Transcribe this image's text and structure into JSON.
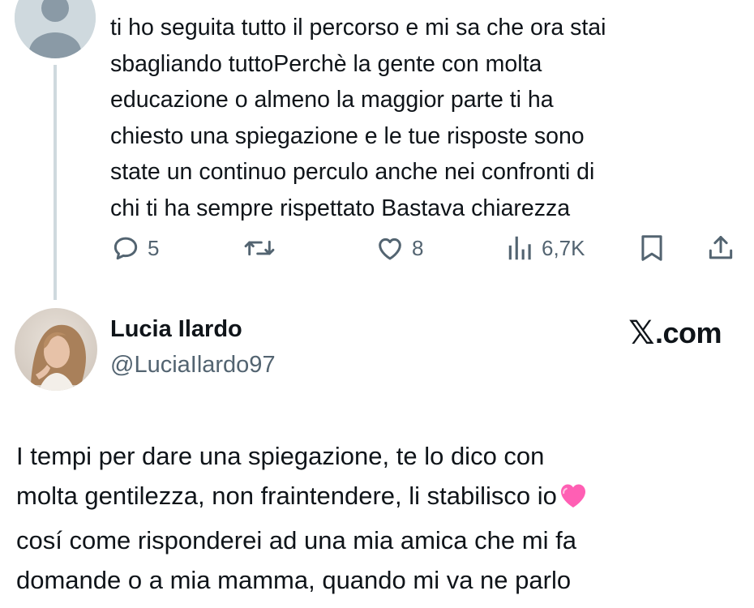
{
  "reply": {
    "text": "ti ho seguita tutto il percorso e mi sa che ora stai\nsbagliando tuttoPerchè la gente con molta\neducazione o almeno la maggior parte ti ha\nchiesto una spiegazione e le tue risposte sono\nstate un continuo perculo anche nei confronti di\nchi ti ha sempre rispettato Bastava chiarezza",
    "stats": {
      "replies": "5",
      "likes": "8",
      "views": "6,7K"
    },
    "icons": {
      "reply": "reply-icon",
      "retweet": "retweet-icon",
      "like": "heart-icon",
      "views": "views-icon",
      "bookmark": "bookmark-icon",
      "share": "share-icon"
    }
  },
  "author": {
    "name": "Lucia Ilardo",
    "handle": "@LuciaIlardo97"
  },
  "brand": {
    "x": "𝕏",
    "domain": ".com"
  },
  "main": {
    "text_lines": [
      "I tempi per dare una spiegazione, te lo dico con",
      "molta gentilezza, non fraintendere, li stabilisco io",
      "cosí come risponderei ad una mia amica che mi fa",
      "domande o a mia mamma, quando mi va ne parlo"
    ],
    "emoji": "pink-heart"
  },
  "colors": {
    "text": "#0f1419",
    "muted": "#536471",
    "thread_line": "#cfd9de",
    "heart_emoji": "#ff5fb4"
  }
}
